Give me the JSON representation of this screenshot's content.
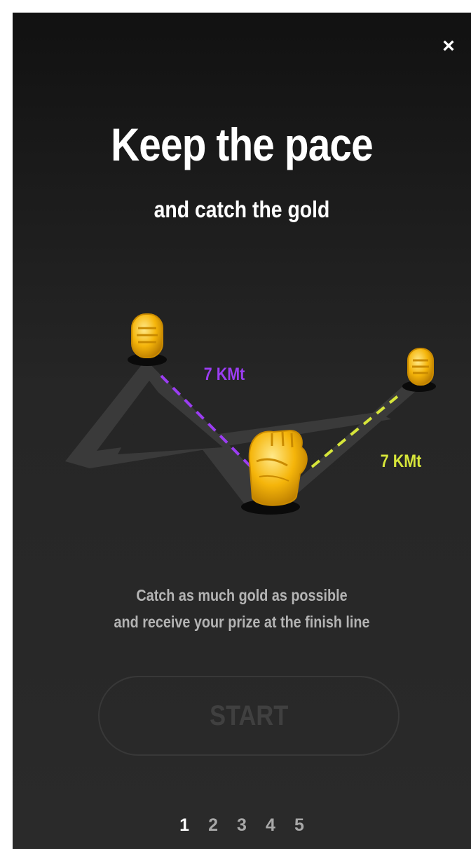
{
  "header": {
    "close_label": "×"
  },
  "intro": {
    "title": "Keep the pace",
    "subtitle": "and catch the gold"
  },
  "illustration": {
    "left_distance": "7 KMt",
    "right_distance": "7 KMt",
    "colors": {
      "left_path": "#9b3df2",
      "right_path": "#d7e63a",
      "gold": "#f5b50a",
      "track": "#404040"
    }
  },
  "description": {
    "line1": "Catch as much gold as possible",
    "line2": "and receive your prize at the finish line"
  },
  "actions": {
    "start_label": "START",
    "start_enabled": false
  },
  "pagination": {
    "pages": [
      "1",
      "2",
      "3",
      "4",
      "5"
    ],
    "current_page": "1"
  }
}
